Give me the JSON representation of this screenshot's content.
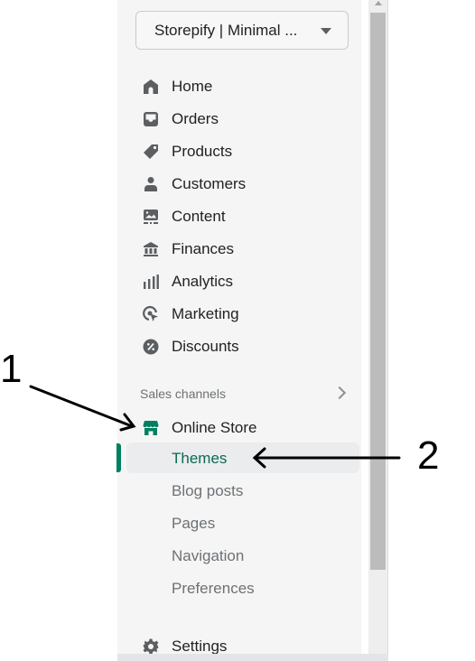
{
  "store_selector": {
    "label": "Storepify | Minimal ...",
    "icon": "caret-down-icon"
  },
  "nav": {
    "items": [
      {
        "label": "Home",
        "icon": "home-icon"
      },
      {
        "label": "Orders",
        "icon": "inbox-icon"
      },
      {
        "label": "Products",
        "icon": "tag-icon"
      },
      {
        "label": "Customers",
        "icon": "person-icon"
      },
      {
        "label": "Content",
        "icon": "image-content-icon"
      },
      {
        "label": "Finances",
        "icon": "bank-icon"
      },
      {
        "label": "Analytics",
        "icon": "bar-chart-icon"
      },
      {
        "label": "Marketing",
        "icon": "target-cursor-icon"
      },
      {
        "label": "Discounts",
        "icon": "discount-badge-icon"
      }
    ]
  },
  "sales_channels": {
    "heading": "Sales channels",
    "online_store": {
      "label": "Online Store",
      "icon": "storefront-icon"
    },
    "sub_items": [
      {
        "label": "Themes",
        "active": true
      },
      {
        "label": "Blog posts",
        "active": false
      },
      {
        "label": "Pages",
        "active": false
      },
      {
        "label": "Navigation",
        "active": false
      },
      {
        "label": "Preferences",
        "active": false
      }
    ]
  },
  "settings": {
    "label": "Settings",
    "icon": "gear-icon"
  },
  "annotations": [
    {
      "number": "1",
      "target": "Online Store"
    },
    {
      "number": "2",
      "target": "Themes"
    }
  ],
  "colors": {
    "accent": "#008060",
    "active_text": "#0b6b52",
    "sidebar_bg": "#f5f5f5",
    "icon": "#5c5f62"
  }
}
